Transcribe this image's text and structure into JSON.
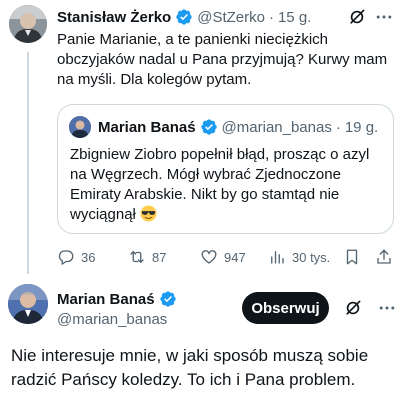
{
  "reply_tweet": {
    "author_name": "Stanisław Żerko",
    "handle": "@StZerko",
    "separator": "·",
    "time": "15 g.",
    "text": "Panie Marianie, a te panienki nieciężkich obczyjaków nadal u Pana przyjmują? Kurwy mam na myśli. Dla kolegów pytam.",
    "verified_icon": "verified-badge-icon",
    "quoted_tweet": {
      "author_name": "Marian Banaś",
      "handle": "@marian_banas",
      "separator": "·",
      "time": "19 g.",
      "text": "Zbigniew Ziobro popełnił błąd, prosząc o azyl na Węgrzech. Mógł wybrać Zjednoczone Emiraty Arabskie. Nikt by go stamtąd nie wyciągnął",
      "emoji": "smiling-face-with-sunglasses"
    },
    "actions": {
      "replies": "36",
      "reposts": "87",
      "likes": "947",
      "views": "30 tys."
    }
  },
  "main_tweet": {
    "author_name": "Marian Banaś",
    "handle": "@marian_banas",
    "follow_label": "Obserwuj",
    "text": "Nie interesuje mnie, w jaki sposób muszą sobie radzić Pańscy koledzy. To ich i Pana problem."
  },
  "colors": {
    "verified_blue": "#1d9bf0",
    "text_primary": "#0f1419",
    "text_secondary": "#536471",
    "border": "#cfd9de",
    "follow_button_bg": "#0f1419"
  }
}
